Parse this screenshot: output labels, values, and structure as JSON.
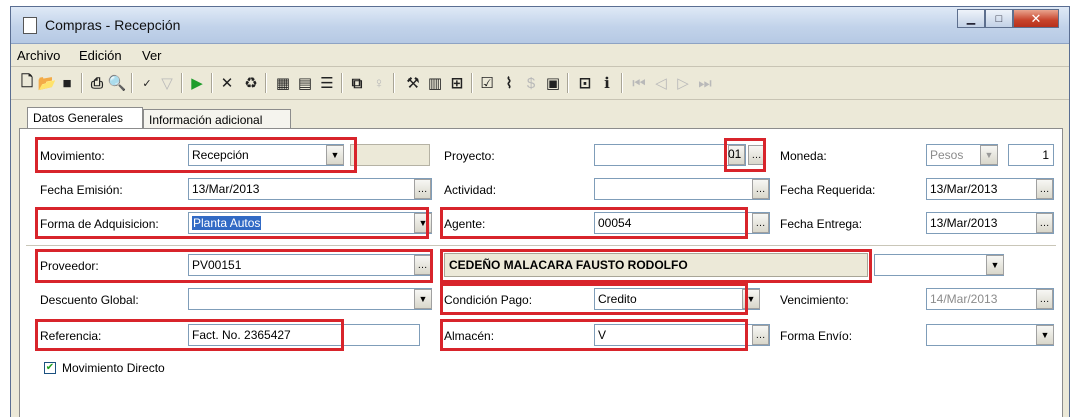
{
  "window": {
    "title": "Compras - Recepción"
  },
  "menu": [
    "Archivo",
    "Edición",
    "Ver"
  ],
  "toolbar": {
    "icons": [
      "new-icon",
      "open-icon",
      "save-icon",
      "print-icon",
      "preview-icon",
      "spellcheck-icon",
      "filter-icon",
      "run-icon",
      "cancel-icon",
      "delete-icon",
      "grid-icon",
      "list-icon",
      "detail-icon",
      "copy-icon",
      "bulb-icon",
      "wand-icon",
      "barcode-icon",
      "table-icon",
      "check-icon",
      "attach-icon",
      "money-icon",
      "calendar-icon",
      "window-icon",
      "info-icon",
      "first-icon",
      "prev-icon",
      "next-icon",
      "last-icon"
    ]
  },
  "tabs": {
    "general": "Datos Generales",
    "extra": "Información adicional"
  },
  "form": {
    "movimiento": {
      "label": "Movimiento:",
      "value": "Recepción"
    },
    "proyecto": {
      "label": "Proyecto:",
      "value": "",
      "code": "01"
    },
    "moneda": {
      "label": "Moneda:",
      "value": "Pesos",
      "rate": "1"
    },
    "fecha_emision": {
      "label": "Fecha Emisión:",
      "value": "13/Mar/2013"
    },
    "actividad": {
      "label": "Actividad:",
      "value": ""
    },
    "fecha_requerida": {
      "label": "Fecha Requerida:",
      "value": "13/Mar/2013"
    },
    "forma_adquisicion": {
      "label": "Forma de Adquisicion:",
      "value": "Planta Autos"
    },
    "agente": {
      "label": "Agente:",
      "value": "00054"
    },
    "fecha_entrega": {
      "label": "Fecha Entrega:",
      "value": "13/Mar/2013"
    },
    "proveedor": {
      "label": "Proveedor:",
      "value": "PV00151",
      "name": "CEDEÑO MALACARA FAUSTO RODOLFO"
    },
    "descuento_global": {
      "label": "Descuento Global:",
      "value": ""
    },
    "condicion_pago": {
      "label": "Condición Pago:",
      "value": "Credito"
    },
    "vencimiento": {
      "label": "Vencimiento:",
      "value": "14/Mar/2013"
    },
    "referencia": {
      "label": "Referencia:",
      "value": "Fact. No. 2365427"
    },
    "almacen": {
      "label": "Almacén:",
      "value": "V"
    },
    "forma_envio": {
      "label": "Forma Envío:",
      "value": ""
    },
    "movimiento_directo": {
      "label": "Movimiento Directo",
      "checked": true
    }
  },
  "colors": {
    "highlight": "#d8242b",
    "selection": "#316ac5"
  }
}
